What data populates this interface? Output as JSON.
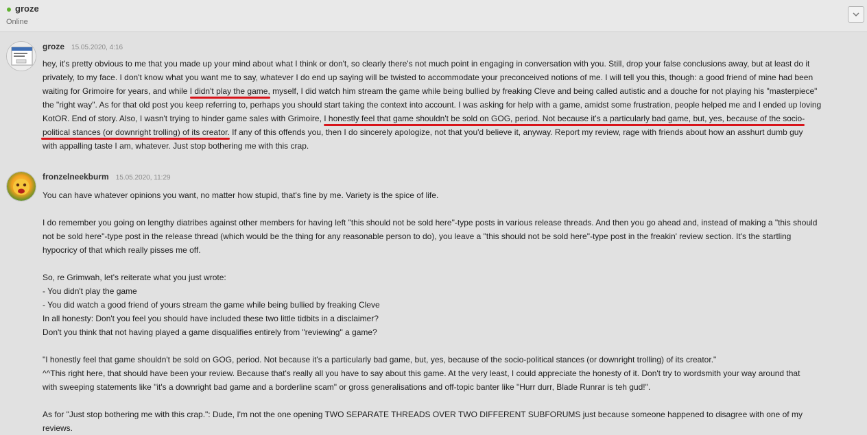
{
  "header": {
    "username": "groze",
    "status": "Online"
  },
  "colors": {
    "online": "#5fb12f",
    "underline": "#d8141a",
    "background": "#e1e1e1"
  },
  "icons": {
    "collapse": "chevron-down-icon",
    "status": "online-dot-icon"
  },
  "messages": [
    {
      "author": "groze",
      "time": "15.05.2020, 4:16",
      "lines": [
        "hey, it's pretty obvious to me that you made up your mind about what I think or don't, so clearly there's not much point in engaging in conversation with you. Still, drop your false conclusions away, but at least do it",
        "privately, to my face. I don't know what you want me to say, whatever I do end up saying will be twisted to accommodate your preconceived notions of me. I will tell you this, though: a good friend of mine had been",
        "waiting for Grimoire for years, and while ",
        "I didn't play the game,",
        " myself, I did watch him stream the game while being bullied by freaking Cleve and being called autistic and a douche for not playing his \"masterpiece\"",
        "the \"right way\". As for that old post you keep referring to, perhaps you should start taking the context into account. I was asking for help with a game, amidst some frustration, people helped me and I ended up loving",
        "KotOR. End of story. Also, I wasn't trying to hinder game sales with Grimoire, ",
        "I honestly feel that game shouldn't be sold on GOG, period. Not because it's a particularly bad game, but, yes, because of the socio-",
        "political stances (or downright trolling) of its creator.",
        " If any of this offends you, then I do sincerely apologize, not that you'd believe it, anyway. Report my review, rage with friends about how an asshurt dumb guy",
        "with appalling taste I am, whatever. Just stop bothering me with this crap."
      ]
    },
    {
      "author": "fronzelneekburm",
      "time": "15.05.2020, 11:29",
      "lines": [
        "You can have whatever opinions you want, no matter how stupid, that's fine by me. Variety is the spice of life.",
        "I do remember you going on lengthy diatribes against other members for having left \"this should not be sold here\"-type posts in various release threads. And then you go ahead and, instead of making a \"this should",
        "not be sold here\"-type post in the release thread (which would be the thing for any reasonable person to do), you leave a \"this should not be sold here\"-type post in the freakin' review section. It's the startling",
        "hypocricy of that which really pisses me off.",
        "So, re Grimwah, let's reiterate what you just wrote:",
        "- You didn't play the game",
        "- You did watch a good friend of yours stream the game while being bullied by freaking Cleve",
        "In all honesty: Don't you feel you should have included these two little tidbits in a disclaimer?",
        "Don't you think that not having played a game disqualifies entirely from \"reviewing\" a game?",
        "\"I honestly feel that game shouldn't be sold on GOG, period. Not because it's a particularly bad game, but, yes, because of the socio-political stances (or downright trolling) of its creator.\"",
        "^^This right here, that should have been your review. Because that's really all you have to say about this game. At the very least, I could appreciate the honesty of it. Don't try to wordsmith your way around that",
        "with sweeping statements like \"it's a downright bad game and a borderline scam\" or gross generalisations and off-topic banter like \"Hurr durr, Blade Runrar is teh gud!\".",
        "As for \"Just stop bothering me with this crap.\": Dude, I'm not the one opening TWO SEPARATE THREADS OVER TWO DIFFERENT SUBFORUMS just because someone happened to disagree with one of my",
        "reviews."
      ]
    }
  ]
}
